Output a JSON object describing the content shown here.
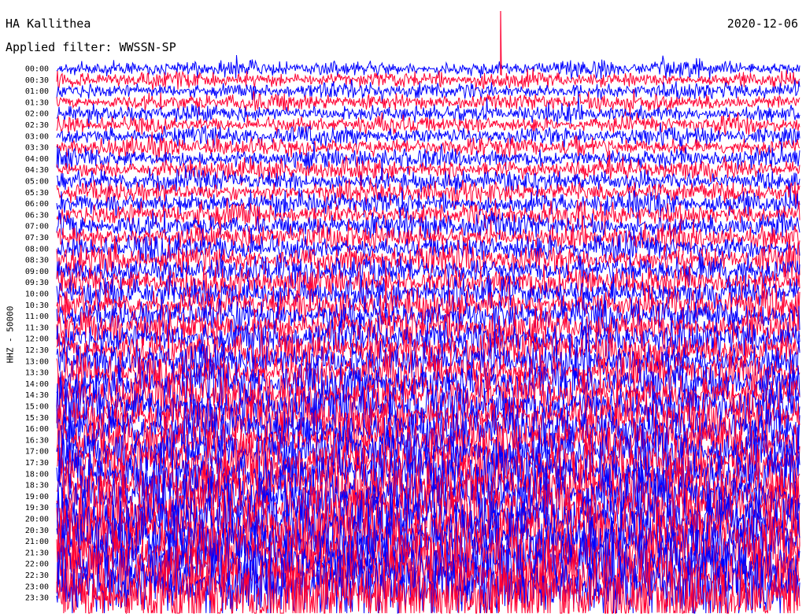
{
  "header": {
    "station": "HA Kallithea",
    "date": "2020-12-06",
    "filter": "Applied filter: WWSSN-SP"
  },
  "chart_data": {
    "type": "line",
    "title": "HA Kallithea",
    "date": "2020-12-06",
    "filter": "Applied filter: WWSSN-SP",
    "ylabel": "HHZ - 50000",
    "xlabel": "",
    "tick_labels": [
      "00:00",
      "00:30",
      "01:00",
      "01:30",
      "02:00",
      "02:30",
      "03:00",
      "03:30",
      "04:00",
      "04:30",
      "05:00",
      "05:30",
      "06:00",
      "06:30",
      "07:00",
      "07:30",
      "08:00",
      "08:30",
      "09:00",
      "09:30",
      "10:00",
      "10:30",
      "11:00",
      "11:30",
      "12:00",
      "12:30",
      "13:00",
      "13:30",
      "14:00",
      "14:30",
      "15:00",
      "15:30",
      "16:00",
      "16:30",
      "17:00",
      "17:30",
      "18:00",
      "18:30",
      "19:00",
      "19:30",
      "20:00",
      "20:30",
      "21:00",
      "21:30",
      "22:00",
      "22:30",
      "23:00",
      "23:30"
    ],
    "trace_colors": [
      "#0000ff",
      "#ff0033"
    ],
    "grid": false,
    "legend": "none"
  }
}
